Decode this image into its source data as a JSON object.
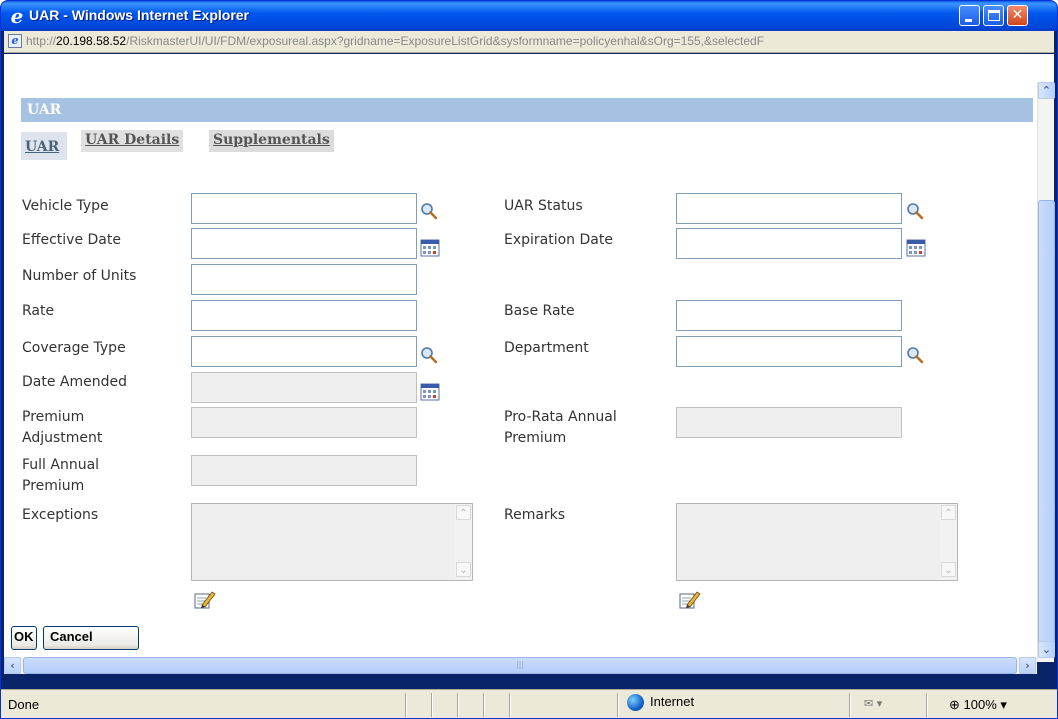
{
  "window": {
    "title": "UAR - Windows Internet Explorer",
    "address": {
      "prefix": "http://",
      "host": "20.198.58.52",
      "path": "/RiskmasterUI/UI/FDM/exposureal.aspx?gridname=ExposureListGrid&sysformname=policyenhal&sOrg=155,&selectedF"
    }
  },
  "form": {
    "section_title": "UAR",
    "tabs": [
      {
        "label": "UAR",
        "active": true
      },
      {
        "label": "UAR Details",
        "active": false
      },
      {
        "label": "Supplementals",
        "active": false
      }
    ],
    "fields": {
      "vehicle_type": {
        "label": "Vehicle Type",
        "value": "",
        "icon": "search-icon"
      },
      "uar_status": {
        "label": "UAR Status",
        "value": "",
        "icon": "search-icon"
      },
      "effective_date": {
        "label": "Effective Date",
        "value": "",
        "icon": "calendar-icon"
      },
      "expiration_date": {
        "label": "Expiration Date",
        "value": "",
        "icon": "calendar-icon"
      },
      "number_of_units": {
        "label": "Number of Units",
        "value": ""
      },
      "rate": {
        "label": "Rate",
        "value": ""
      },
      "base_rate": {
        "label": "Base Rate",
        "value": ""
      },
      "coverage_type": {
        "label": "Coverage Type",
        "value": "",
        "icon": "search-icon"
      },
      "department": {
        "label": "Department",
        "value": "",
        "icon": "search-icon"
      },
      "date_amended": {
        "label": "Date Amended",
        "value": "",
        "readonly": true,
        "icon": "calendar-icon"
      },
      "premium_adjustment": {
        "label_line1": "Premium",
        "label_line2": "Adjustment",
        "value": "",
        "readonly": true
      },
      "pro_rata_annual_premium": {
        "label_line1": "Pro-Rata Annual",
        "label_line2": "Premium",
        "value": "",
        "readonly": true
      },
      "full_annual_premium": {
        "label_line1": "Full Annual",
        "label_line2": "Premium",
        "value": "",
        "readonly": true
      },
      "exceptions": {
        "label": "Exceptions",
        "value": "",
        "readonly": true,
        "icon": "edit-icon"
      },
      "remarks": {
        "label": "Remarks",
        "value": "",
        "readonly": true,
        "icon": "edit-icon"
      }
    },
    "buttons": {
      "ok": "OK",
      "cancel": "Cancel"
    }
  },
  "status_bar": {
    "text": "Done",
    "zone": "Internet",
    "zoom": "100%"
  },
  "colors": {
    "titlebar": "#0058ee",
    "section_header": "#a6c2e2",
    "chrome": "#ece9d8"
  }
}
